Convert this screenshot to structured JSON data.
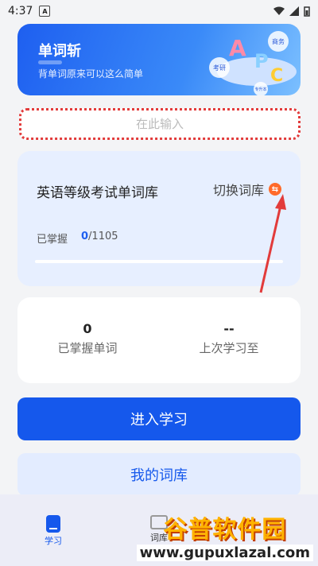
{
  "status": {
    "time": "4:37",
    "badge": "A"
  },
  "banner": {
    "title": "单词斩",
    "subtitle": "背单词原来可以这么简单",
    "tags": [
      "考研",
      "商务",
      "专升本"
    ]
  },
  "search": {
    "placeholder": "在此输入"
  },
  "library": {
    "name": "英语等级考试单词库",
    "switch_label": "切换词库",
    "mastered_label": "已掌握",
    "mastered_count": "0",
    "total": "/1105",
    "progress": 0
  },
  "stats": {
    "mastered_value": "0",
    "mastered_label": "已掌握单词",
    "last_value": "--",
    "last_label": "上次学习至"
  },
  "buttons": {
    "start": "进入学习",
    "my_library": "我的词库"
  },
  "nav": {
    "study": "学习",
    "library": "词库"
  },
  "watermark": {
    "main": "谷普软件园",
    "url": "www.gupuxlazal.com"
  },
  "colors": {
    "accent": "#1558ec",
    "annotation": "#e23b3b"
  }
}
